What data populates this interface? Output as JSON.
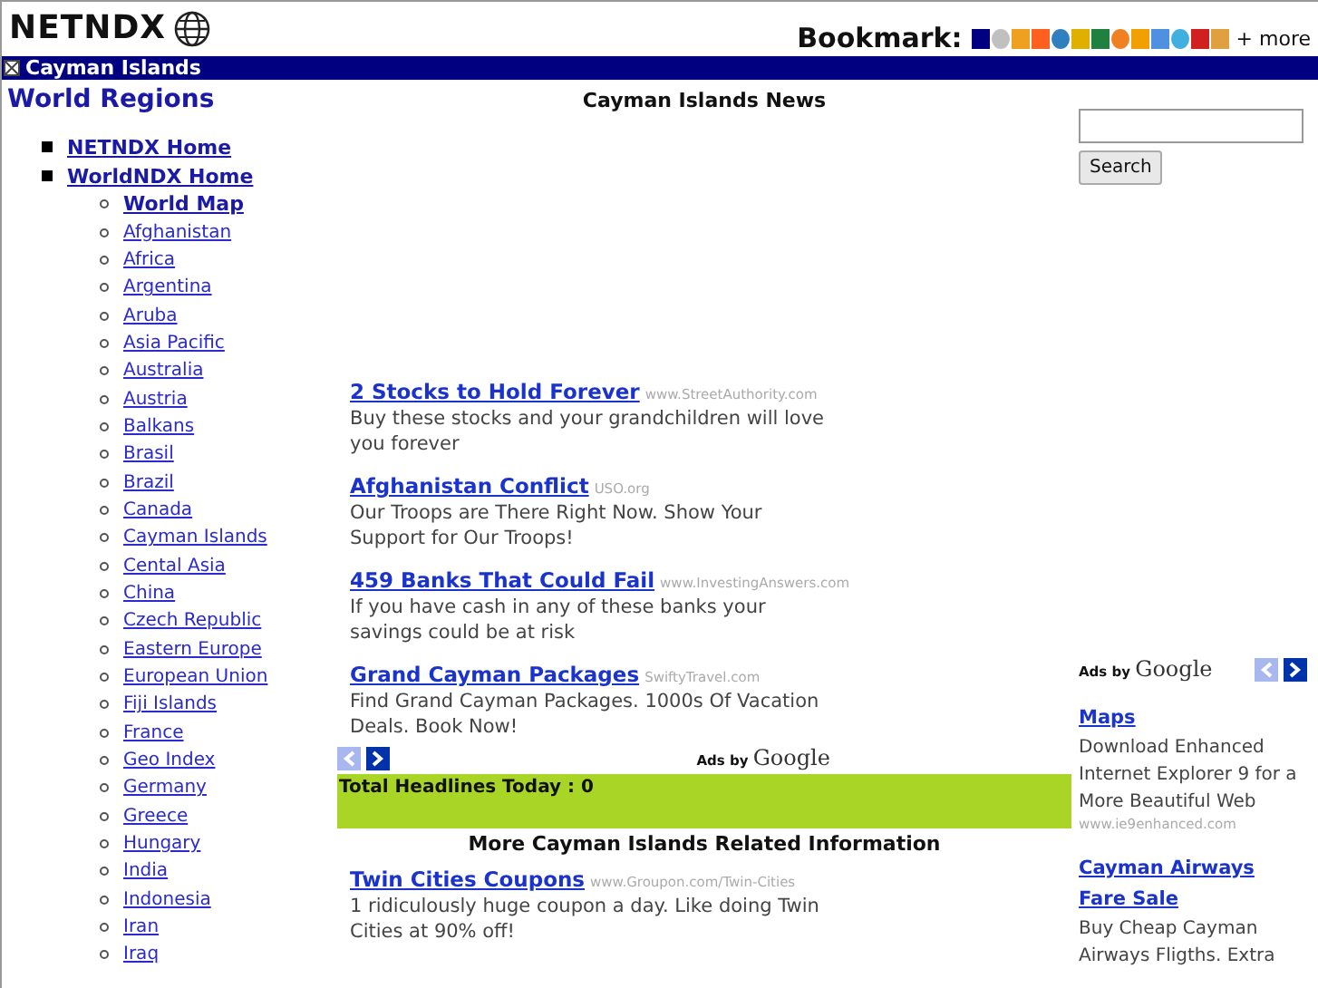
{
  "header": {
    "logo": "NETNDX",
    "bookmark_label": "Bookmark:",
    "bookmark_icons": [
      {
        "color": "#000080"
      },
      {
        "color": "#c0c0c0"
      },
      {
        "color": "#f0a020"
      },
      {
        "color": "#ff6020"
      },
      {
        "color": "#3080c0"
      },
      {
        "color": "#e0b000"
      },
      {
        "color": "#208040"
      },
      {
        "color": "#f08020"
      },
      {
        "color": "#f0a000"
      },
      {
        "color": "#5090e0"
      },
      {
        "color": "#40b0e0"
      },
      {
        "color": "#d02020"
      },
      {
        "color": "#e0a040"
      }
    ],
    "more": "+ more"
  },
  "title_bar": {
    "title": "Cayman Islands"
  },
  "sidebar": {
    "heading": "World Regions",
    "items": [
      {
        "label": "NETNDX Home"
      },
      {
        "label": "WorldNDX Home",
        "children": [
          {
            "label": "World Map",
            "bold": true
          },
          {
            "label": "Afghanistan",
            "bold": false
          },
          {
            "label": "Africa",
            "bold": false
          },
          {
            "label": "Argentina",
            "bold": false
          },
          {
            "label": "Aruba",
            "bold": false
          },
          {
            "label": "Asia Pacific",
            "bold": false
          },
          {
            "label": "Australia",
            "bold": false
          },
          {
            "label": "Austria",
            "bold": false
          },
          {
            "label": "Balkans",
            "bold": false
          },
          {
            "label": "Brasil",
            "bold": false
          },
          {
            "label": "Brazil",
            "bold": false
          },
          {
            "label": "Canada",
            "bold": false
          },
          {
            "label": "Cayman Islands",
            "bold": false
          },
          {
            "label": "Cental Asia",
            "bold": false
          },
          {
            "label": "China",
            "bold": false
          },
          {
            "label": "Czech Republic",
            "bold": false
          },
          {
            "label": "Eastern Europe",
            "bold": false
          },
          {
            "label": "European Union",
            "bold": false
          },
          {
            "label": "Fiji Islands",
            "bold": false
          },
          {
            "label": "France",
            "bold": false
          },
          {
            "label": "Geo Index",
            "bold": false
          },
          {
            "label": "Germany",
            "bold": false
          },
          {
            "label": "Greece",
            "bold": false
          },
          {
            "label": "Hungary",
            "bold": false
          },
          {
            "label": "India",
            "bold": false
          },
          {
            "label": "Indonesia",
            "bold": false
          },
          {
            "label": "Iran",
            "bold": false
          },
          {
            "label": "Iraq",
            "bold": false
          }
        ]
      }
    ]
  },
  "main": {
    "heading": "Cayman Islands News",
    "ads": [
      {
        "title": "2 Stocks to Hold Forever",
        "url": "www.StreetAuthority.com",
        "description": "Buy these stocks and your grandchildren will love you forever"
      },
      {
        "title": "Afghanistan Conflict",
        "url": "USO.org",
        "description": "Our Troops are There Right Now. Show Your Support for Our Troops!"
      },
      {
        "title": "459 Banks That Could Fail",
        "url": "www.InvestingAnswers.com",
        "description": "If you have cash in any of these banks your savings could be at risk"
      },
      {
        "title": "Grand Cayman Packages",
        "url": "SwiftyTravel.com",
        "description": "Find Grand Cayman Packages. 1000s Of Vacation Deals. Book Now!"
      }
    ],
    "ad_nav": {
      "prev_disabled": true,
      "next_disabled": false
    },
    "ads_label": "Ads by",
    "ads_brand": "Google",
    "headlines": "Total Headlines Today : 0",
    "related_heading": "More Cayman Islands Related Information",
    "related_ads": [
      {
        "title": "Twin Cities Coupons",
        "url": "www.Groupon.com/Twin-Cities",
        "description": "1 ridiculously huge coupon a day. Like doing Twin Cities at 90% off!"
      }
    ]
  },
  "right": {
    "search_button": "Search",
    "ads_label": "Ads by",
    "ads_brand": "Google",
    "ad_nav": {
      "prev_disabled": true,
      "next_disabled": false
    },
    "ads": [
      {
        "title": "Maps",
        "description": "Download Enhanced Internet Explorer 9 for a More Beautiful Web",
        "url": "www.ie9enhanced.com"
      },
      {
        "title": "Cayman Airways Fare Sale",
        "description": "Buy Cheap Cayman Airways Fligths. Extra"
      }
    ]
  }
}
